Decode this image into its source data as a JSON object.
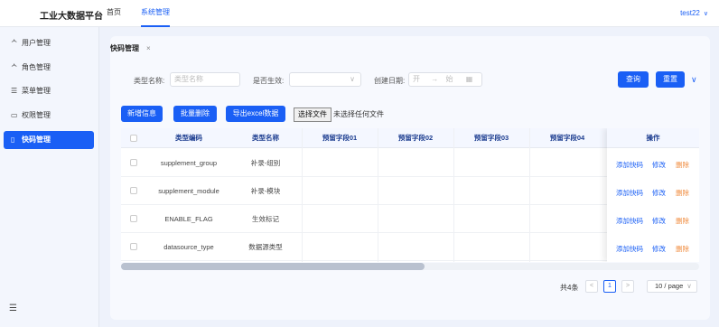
{
  "header": {
    "brand": "工业大数据平台",
    "nav": [
      {
        "label": "首页",
        "active": false
      },
      {
        "label": "系统管理",
        "active": true
      }
    ],
    "user": "test22",
    "user_chevron": "∨"
  },
  "sidebar": {
    "items": [
      {
        "icon": "user-icon",
        "glyph": "ᄉ",
        "label": "用户管理",
        "active": false
      },
      {
        "icon": "role-icon",
        "glyph": "ᄉ",
        "label": "角色管理",
        "active": false
      },
      {
        "icon": "menu-icon",
        "glyph": "☰",
        "label": "菜单管理",
        "active": false
      },
      {
        "icon": "monitor-icon",
        "glyph": "▭",
        "label": "权限管理",
        "active": false
      },
      {
        "icon": "document-icon",
        "glyph": "▯",
        "label": "快码管理",
        "active": true
      }
    ],
    "collapse_icon": "☰"
  },
  "tab": {
    "label": "快码管理",
    "close": "×"
  },
  "filters": {
    "type_name_label": "类型名称:",
    "type_name_placeholder": "类型名称",
    "active_label": "是否生效:",
    "active_chevron": "∨",
    "created_label": "创建日期:",
    "date_start": "开",
    "date_arrow": "→",
    "date_end": "始",
    "calendar_glyph": "▦",
    "search_button": "查询",
    "reset_button": "重置",
    "expand_chevron": "∨"
  },
  "toolbar": {
    "add": "新增信息",
    "batch_delete": "批量删除",
    "export": "导出excel数据",
    "choose_file": "选择文件",
    "no_file": "未选择任何文件"
  },
  "table": {
    "columns": [
      "类型编码",
      "类型名称",
      "预留字段01",
      "预留字段02",
      "预留字段03",
      "预留字段04",
      "操作"
    ],
    "rows": [
      {
        "code": "supplement_group",
        "name": "补录-组别"
      },
      {
        "code": "supplement_module",
        "name": "补录-模块"
      },
      {
        "code": "ENABLE_FLAG",
        "name": "生效标记"
      },
      {
        "code": "datasource_type",
        "name": "数据源类型"
      }
    ],
    "actions": {
      "add_code": "添加快码",
      "edit": "修改",
      "delete": "删除"
    }
  },
  "scroll": {
    "thumb_fraction": 0.525
  },
  "pagination": {
    "total": "共4条",
    "prev": "<",
    "page": "1",
    "next": ">",
    "page_size": "10 / page",
    "page_size_chevron": "∨"
  },
  "colors": {
    "primary": "#1a5ff5",
    "danger": "#f08a3c"
  }
}
